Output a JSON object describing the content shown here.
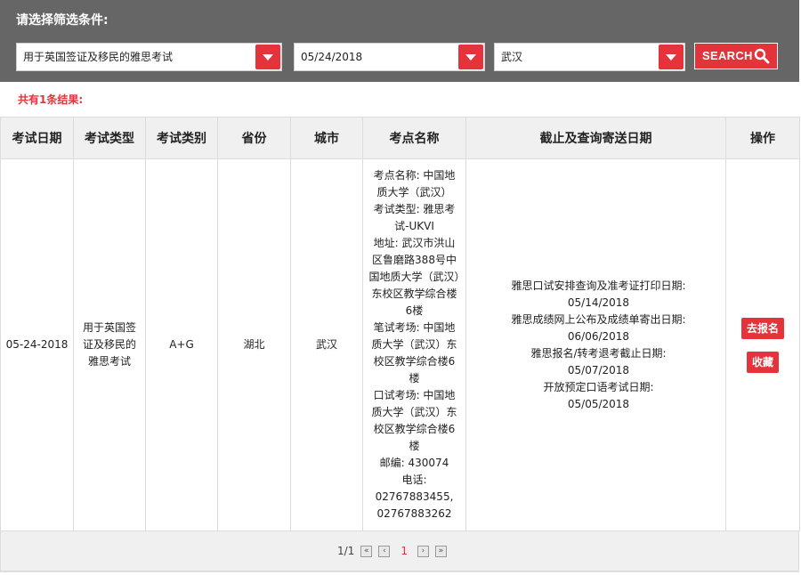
{
  "filter": {
    "title": "请选择筛选条件:",
    "exam_type": "用于英国签证及移民的雅思考试",
    "date": "05/24/2018",
    "city": "武汉",
    "search_label": "SEARCH"
  },
  "result_count": "共有1条结果:",
  "table": {
    "headers": [
      "考试日期",
      "考试类型",
      "考试类别",
      "省份",
      "城市",
      "考点名称",
      "截止及查询寄送日期",
      "操作"
    ],
    "rows": [
      {
        "date": "05-24-2018",
        "type": "用于英国签证及移民的雅思考试",
        "category": "A+G",
        "province": "湖北",
        "city": "武汉",
        "venue": [
          "考点名称: 中国地质大学（武汉）",
          "考试类型: 雅思考试-UKVI",
          "地址: 武汉市洪山区鲁磨路388号中国地质大学（武汉）东校区教学综合楼6楼",
          "笔试考场: 中国地质大学（武汉）东校区教学综合楼6楼",
          "口试考场: 中国地质大学（武汉）东校区教学综合楼6楼",
          "邮编: 430074",
          "电话: 02767883455, 02767883262"
        ],
        "deadlines": [
          "雅思口试安排查询及准考证打印日期:",
          "05/14/2018",
          "雅思成绩网上公布及成绩单寄出日期:",
          "06/06/2018",
          "雅思报名/转考退考截止日期:",
          "05/07/2018",
          "开放预定口语考试日期:",
          "05/05/2018"
        ],
        "actions": {
          "register": "去报名",
          "favorite": "收藏"
        }
      }
    ]
  },
  "pagination": {
    "summary": "1/1",
    "current": "1"
  },
  "colors": {
    "accent": "#e4333a",
    "panel": "#666666"
  }
}
